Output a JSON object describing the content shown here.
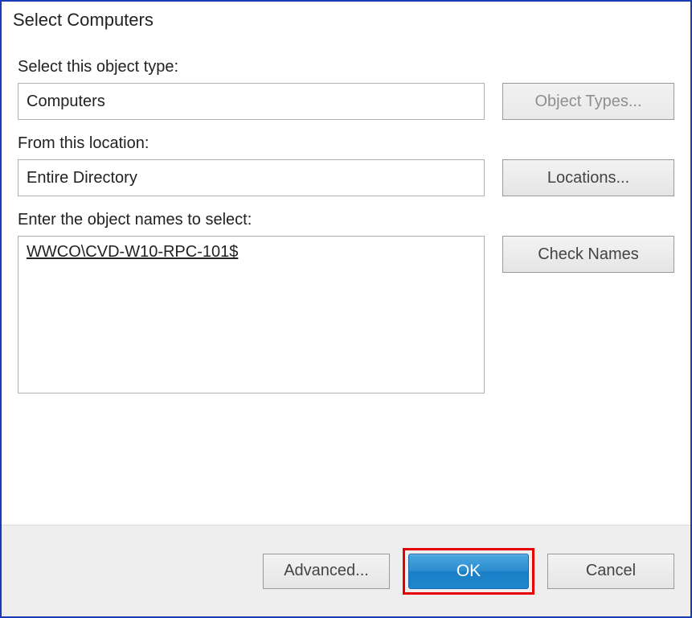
{
  "window": {
    "title": "Select Computers"
  },
  "labels": {
    "object_type": "Select this object type:",
    "location": "From this location:",
    "names": "Enter the object names to select:"
  },
  "values": {
    "object_type": "Computers",
    "location": "Entire Directory",
    "names": "WWCO\\CVD-W10-RPC-101$"
  },
  "buttons": {
    "object_types": "Object Types...",
    "locations": "Locations...",
    "check_names": "Check Names",
    "advanced": "Advanced...",
    "ok": "OK",
    "cancel": "Cancel"
  },
  "state": {
    "object_types_enabled": false
  },
  "highlight": {
    "element": "ok-button",
    "color": "#e60000"
  }
}
